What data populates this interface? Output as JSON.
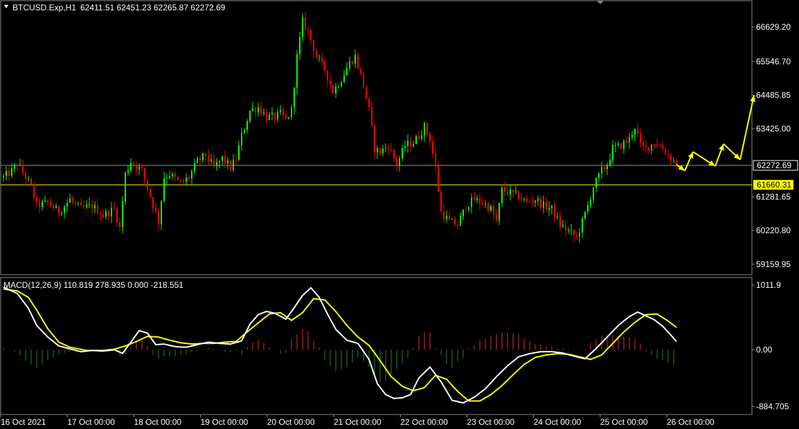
{
  "window": {
    "symbol_header": "BTCUSD.Exp,H1",
    "ohlc_header": "62411.51 62451.23 62265.87 62272.69",
    "macd_header": "MACD(12,26,9) 110.819 278.935 0.000 -218.551"
  },
  "colors": {
    "background": "#000000",
    "bull": "#00ff00",
    "bear": "#ff0000",
    "macd_hist_pos": "#e03030",
    "macd_hist_neg": "#1f8a1f",
    "macd_line": "#ffffff",
    "signal_line": "#ffff00",
    "forecast": "#ffff00",
    "current_price_line": "#8a9aa8",
    "level_line": "#ffff00"
  },
  "chart_data": [
    {
      "type": "candlestick",
      "price_ticks": [
        {
          "value": 66629.2,
          "label": "66629.20"
        },
        {
          "value": 65546.7,
          "label": "65546.70"
        },
        {
          "value": 64485.85,
          "label": "64485.85"
        },
        {
          "value": 63425.0,
          "label": "63425.00"
        },
        {
          "value": 61281.65,
          "label": "61281.65"
        },
        {
          "value": 60220.8,
          "label": "60220.80"
        },
        {
          "value": 59159.95,
          "label": "59159.95"
        }
      ],
      "ylim": [
        58850,
        67440
      ],
      "current_price": {
        "value": 62272.69,
        "label": "62272.69"
      },
      "level_line": {
        "value": 61660.31,
        "label": "61660.31"
      },
      "x_labels": [
        "16 Oct 2021",
        "17 Oct 00:00",
        "18 Oct 00:00",
        "19 Oct 00:00",
        "20 Oct 00:00",
        "21 Oct 00:00",
        "22 Oct 00:00",
        "23 Oct 00:00",
        "24 Oct 00:00",
        "25 Oct 00:00",
        "26 Oct 00:00"
      ],
      "close_path": [
        [
          0,
          61900
        ],
        [
          3,
          62100
        ],
        [
          5,
          62350
        ],
        [
          8,
          61900
        ],
        [
          10,
          61600
        ],
        [
          12,
          61000
        ],
        [
          16,
          61100
        ],
        [
          20,
          60800
        ],
        [
          24,
          61200
        ],
        [
          28,
          60900
        ],
        [
          32,
          61000
        ],
        [
          36,
          60700
        ],
        [
          40,
          60900
        ],
        [
          42,
          60300
        ],
        [
          44,
          62000
        ],
        [
          46,
          62400
        ],
        [
          50,
          62100
        ],
        [
          53,
          61300
        ],
        [
          56,
          60500
        ],
        [
          58,
          61900
        ],
        [
          60,
          62000
        ],
        [
          64,
          61700
        ],
        [
          67,
          61900
        ],
        [
          70,
          62400
        ],
        [
          73,
          62600
        ],
        [
          76,
          62200
        ],
        [
          79,
          62500
        ],
        [
          82,
          62200
        ],
        [
          84,
          62500
        ],
        [
          86,
          63200
        ],
        [
          89,
          64000
        ],
        [
          92,
          64100
        ],
        [
          95,
          63800
        ],
        [
          98,
          63800
        ],
        [
          100,
          63900
        ],
        [
          102,
          63700
        ],
        [
          104,
          64000
        ],
        [
          106,
          65700
        ],
        [
          108,
          66800
        ],
        [
          110,
          66500
        ],
        [
          113,
          65700
        ],
        [
          116,
          65300
        ],
        [
          119,
          64600
        ],
        [
          122,
          65000
        ],
        [
          125,
          65500
        ],
        [
          127,
          65700
        ],
        [
          130,
          64800
        ],
        [
          132,
          64000
        ],
        [
          134,
          62800
        ],
        [
          136,
          62700
        ],
        [
          139,
          62900
        ],
        [
          142,
          62300
        ],
        [
          145,
          62900
        ],
        [
          148,
          63000
        ],
        [
          150,
          63200
        ],
        [
          152,
          63500
        ],
        [
          154,
          63100
        ],
        [
          156,
          62200
        ],
        [
          158,
          60800
        ],
        [
          161,
          60500
        ],
        [
          164,
          60400
        ],
        [
          167,
          61000
        ],
        [
          170,
          61200
        ],
        [
          173,
          61100
        ],
        [
          176,
          60900
        ],
        [
          178,
          60500
        ],
        [
          180,
          61500
        ],
        [
          183,
          61400
        ],
        [
          186,
          61300
        ],
        [
          189,
          61100
        ],
        [
          192,
          61200
        ],
        [
          195,
          61000
        ],
        [
          198,
          60900
        ],
        [
          201,
          60400
        ],
        [
          204,
          60200
        ],
        [
          207,
          60000
        ],
        [
          209,
          60500
        ],
        [
          211,
          61000
        ],
        [
          213,
          61600
        ],
        [
          216,
          62100
        ],
        [
          218,
          62300
        ],
        [
          220,
          62800
        ],
        [
          223,
          62900
        ],
        [
          226,
          63100
        ],
        [
          228,
          63500
        ],
        [
          230,
          62900
        ],
        [
          232,
          62800
        ],
        [
          235,
          63000
        ],
        [
          238,
          62800
        ],
        [
          240,
          62600
        ],
        [
          242,
          62400
        ],
        [
          243,
          62272.69
        ]
      ],
      "candle_count": 244,
      "forecast_points": [
        {
          "i": 243,
          "v": 62300
        },
        {
          "i": 246,
          "v": 62100
        },
        {
          "i": 249,
          "v": 62700
        },
        {
          "i": 257,
          "v": 62250
        },
        {
          "i": 260,
          "v": 62950
        },
        {
          "i": 266,
          "v": 62450
        },
        {
          "i": 271,
          "v": 64480
        }
      ]
    },
    {
      "type": "macd",
      "params": "MACD(12,26,9)",
      "ylim": [
        -1000,
        1120
      ],
      "ticks": [
        {
          "value": 1011.9,
          "label": "1011.9"
        },
        {
          "value": 0.0,
          "label": "0.00"
        },
        {
          "value": -884.705,
          "label": "-884.705"
        }
      ],
      "macd_path": [
        [
          0,
          980
        ],
        [
          5,
          880
        ],
        [
          9,
          650
        ],
        [
          12,
          380
        ],
        [
          16,
          200
        ],
        [
          20,
          60
        ],
        [
          24,
          15
        ],
        [
          28,
          -30
        ],
        [
          32,
          -10
        ],
        [
          36,
          -20
        ],
        [
          40,
          0
        ],
        [
          43,
          -55
        ],
        [
          46,
          120
        ],
        [
          49,
          300
        ],
        [
          52,
          260
        ],
        [
          55,
          80
        ],
        [
          58,
          90
        ],
        [
          62,
          50
        ],
        [
          66,
          40
        ],
        [
          70,
          80
        ],
        [
          74,
          120
        ],
        [
          78,
          100
        ],
        [
          82,
          90
        ],
        [
          86,
          140
        ],
        [
          89,
          400
        ],
        [
          92,
          550
        ],
        [
          95,
          600
        ],
        [
          98,
          570
        ],
        [
          102,
          480
        ],
        [
          105,
          660
        ],
        [
          108,
          850
        ],
        [
          111,
          970
        ],
        [
          114,
          820
        ],
        [
          117,
          560
        ],
        [
          120,
          320
        ],
        [
          124,
          150
        ],
        [
          128,
          100
        ],
        [
          132,
          -150
        ],
        [
          135,
          -530
        ],
        [
          138,
          -700
        ],
        [
          141,
          -760
        ],
        [
          144,
          -750
        ],
        [
          147,
          -700
        ],
        [
          150,
          -440
        ],
        [
          154,
          -270
        ],
        [
          158,
          -500
        ],
        [
          162,
          -790
        ],
        [
          166,
          -830
        ],
        [
          170,
          -740
        ],
        [
          174,
          -610
        ],
        [
          178,
          -420
        ],
        [
          182,
          -250
        ],
        [
          186,
          -110
        ],
        [
          190,
          -60
        ],
        [
          194,
          -30
        ],
        [
          198,
          -30
        ],
        [
          202,
          -50
        ],
        [
          206,
          -100
        ],
        [
          210,
          -140
        ],
        [
          214,
          20
        ],
        [
          218,
          200
        ],
        [
          222,
          380
        ],
        [
          226,
          520
        ],
        [
          229,
          590
        ],
        [
          232,
          530
        ],
        [
          235,
          470
        ],
        [
          238,
          370
        ],
        [
          241,
          230
        ],
        [
          243,
          130
        ]
      ],
      "signal_path": [
        [
          0,
          950
        ],
        [
          5,
          920
        ],
        [
          9,
          820
        ],
        [
          12,
          620
        ],
        [
          16,
          330
        ],
        [
          20,
          120
        ],
        [
          24,
          40
        ],
        [
          30,
          -10
        ],
        [
          36,
          -10
        ],
        [
          40,
          10
        ],
        [
          44,
          60
        ],
        [
          48,
          130
        ],
        [
          52,
          210
        ],
        [
          56,
          200
        ],
        [
          60,
          150
        ],
        [
          64,
          110
        ],
        [
          68,
          90
        ],
        [
          72,
          100
        ],
        [
          76,
          100
        ],
        [
          80,
          120
        ],
        [
          84,
          130
        ],
        [
          88,
          280
        ],
        [
          92,
          420
        ],
        [
          96,
          560
        ],
        [
          100,
          580
        ],
        [
          104,
          460
        ],
        [
          108,
          580
        ],
        [
          112,
          800
        ],
        [
          116,
          780
        ],
        [
          120,
          600
        ],
        [
          124,
          380
        ],
        [
          128,
          200
        ],
        [
          132,
          70
        ],
        [
          136,
          -170
        ],
        [
          140,
          -420
        ],
        [
          144,
          -570
        ],
        [
          148,
          -640
        ],
        [
          152,
          -590
        ],
        [
          156,
          -400
        ],
        [
          160,
          -460
        ],
        [
          164,
          -650
        ],
        [
          168,
          -800
        ],
        [
          172,
          -800
        ],
        [
          176,
          -700
        ],
        [
          180,
          -560
        ],
        [
          184,
          -390
        ],
        [
          188,
          -230
        ],
        [
          192,
          -120
        ],
        [
          196,
          -80
        ],
        [
          200,
          -60
        ],
        [
          204,
          -70
        ],
        [
          208,
          -110
        ],
        [
          212,
          -150
        ],
        [
          216,
          -80
        ],
        [
          220,
          100
        ],
        [
          224,
          280
        ],
        [
          228,
          430
        ],
        [
          232,
          550
        ],
        [
          236,
          560
        ],
        [
          240,
          450
        ],
        [
          243,
          350
        ]
      ]
    }
  ]
}
